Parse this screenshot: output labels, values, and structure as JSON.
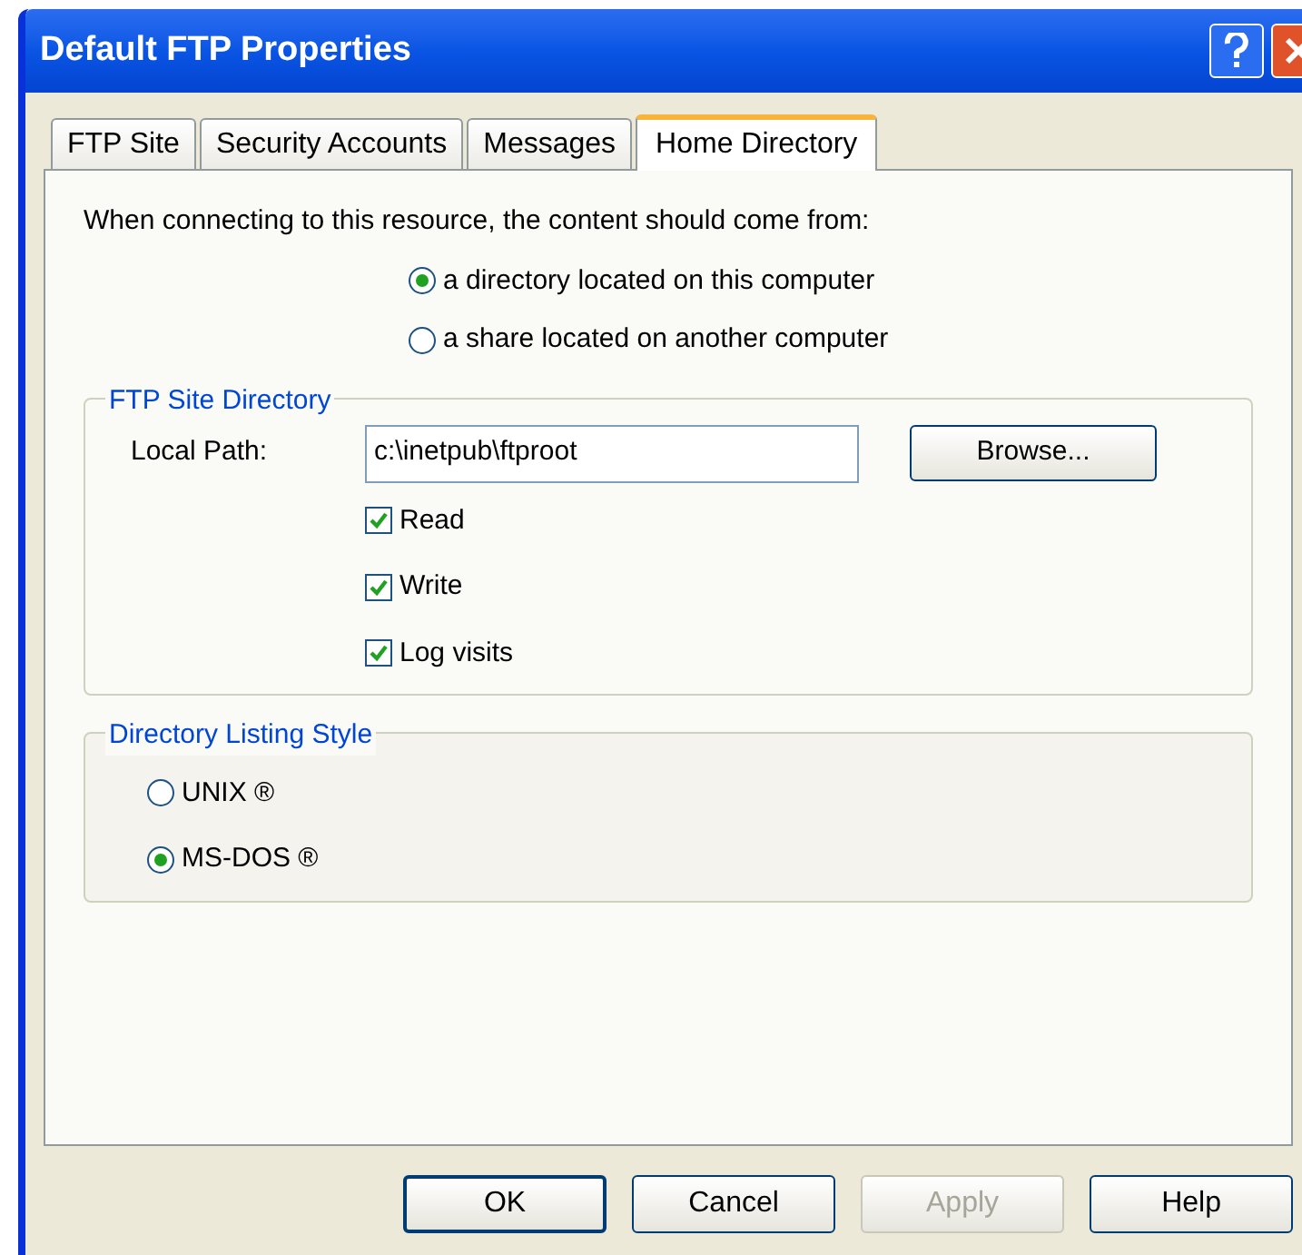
{
  "window": {
    "title": "Default FTP Properties"
  },
  "tabs": [
    {
      "label": "FTP Site",
      "selected": false
    },
    {
      "label": "Security Accounts",
      "selected": false
    },
    {
      "label": "Messages",
      "selected": false
    },
    {
      "label": "Home Directory",
      "selected": true
    }
  ],
  "source": {
    "prompt": "When connecting to this resource, the content should come from:",
    "options": [
      {
        "label": "a directory located on this computer",
        "selected": true
      },
      {
        "label": "a share located on another computer",
        "selected": false
      }
    ]
  },
  "ftp_site_directory": {
    "title": "FTP Site Directory",
    "local_path_label": "Local Path:",
    "local_path": "c:\\inetpub\\ftproot",
    "browse_button": "Browse...",
    "permissions": [
      {
        "label": "Read",
        "checked": true
      },
      {
        "label": "Write",
        "checked": true
      },
      {
        "label": "Log visits",
        "checked": true
      }
    ]
  },
  "listing_style": {
    "title": "Directory Listing Style",
    "options": [
      {
        "label": "UNIX ®",
        "selected": false
      },
      {
        "label": "MS-DOS ®",
        "selected": true
      }
    ]
  },
  "buttons": [
    {
      "label": "OK",
      "disabled": false,
      "default": true
    },
    {
      "label": "Cancel",
      "disabled": false,
      "default": false
    },
    {
      "label": "Apply",
      "disabled": true,
      "default": false
    },
    {
      "label": "Help",
      "disabled": false,
      "default": false
    }
  ]
}
